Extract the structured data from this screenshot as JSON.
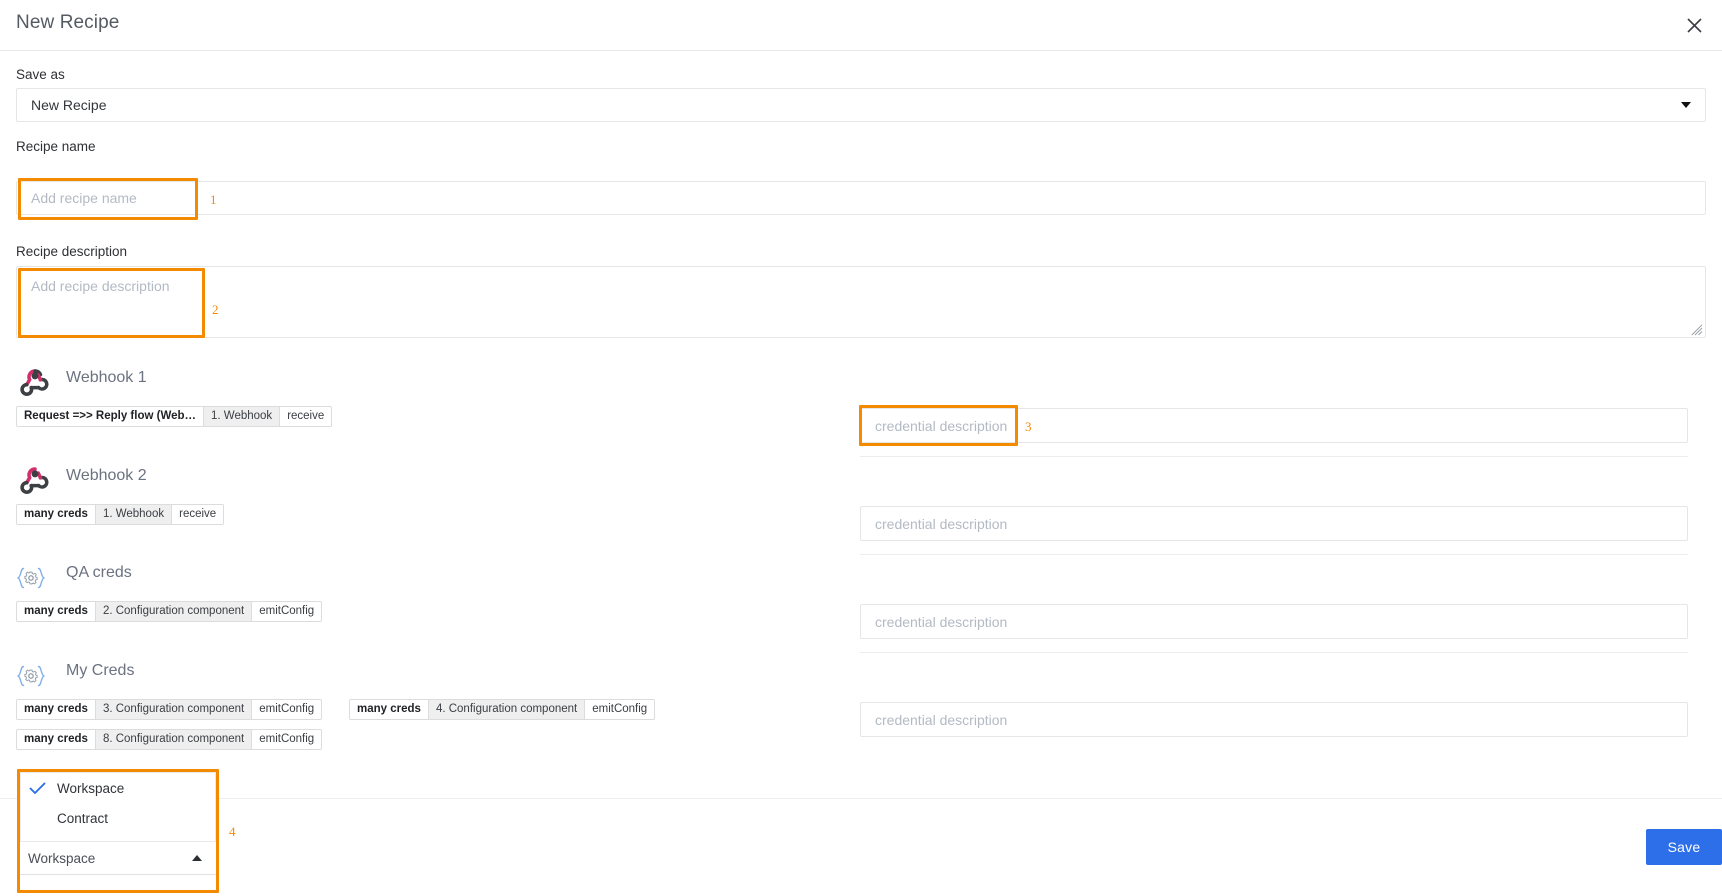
{
  "window": {
    "title": "New Recipe",
    "close_icon": "close-icon"
  },
  "colors": {
    "accent_blue": "#2c6fe8",
    "annotation_orange": "#f48a00",
    "chip_gray": "#efefef",
    "placeholder": "#b3bac4",
    "webhook_pink": "#d1306d",
    "config_blue": "#7fb0e8"
  },
  "form": {
    "save_as": {
      "label": "Save as",
      "value": "New Recipe",
      "caret_icon": "chevron-down-icon"
    },
    "recipe_name": {
      "label": "Recipe name",
      "value": "",
      "placeholder": "Add recipe name"
    },
    "recipe_description": {
      "label": "Recipe description",
      "value": "",
      "placeholder": "Add recipe description"
    }
  },
  "credential_placeholder": "credential description",
  "sections": [
    {
      "icon": "webhook-icon",
      "title": "Webhook 1",
      "credential_value": "",
      "chip_rows": [
        [
          {
            "name": "Request =>> Reply flow (Web…",
            "step": "1. Webhook",
            "action": "receive"
          }
        ]
      ]
    },
    {
      "icon": "webhook-icon",
      "title": "Webhook 2",
      "credential_value": "",
      "chip_rows": [
        [
          {
            "name": "many creds",
            "step": "1. Webhook",
            "action": "receive"
          }
        ]
      ]
    },
    {
      "icon": "config-icon",
      "title": "QA creds",
      "credential_value": "",
      "chip_rows": [
        [
          {
            "name": "many creds",
            "step": "2. Configuration component",
            "action": "emitConfig"
          }
        ]
      ]
    },
    {
      "icon": "config-icon",
      "title": "My Creds",
      "credential_value": "",
      "chip_rows": [
        [
          {
            "name": "many creds",
            "step": "3. Configuration component",
            "action": "emitConfig"
          },
          {
            "name": "many creds",
            "step": "4. Configuration component",
            "action": "emitConfig"
          }
        ],
        [
          {
            "name": "many creds",
            "step": "8. Configuration component",
            "action": "emitConfig"
          }
        ]
      ]
    }
  ],
  "scope_dropdown": {
    "selected": "Workspace",
    "caret_icon": "chevron-up-icon",
    "options": [
      {
        "label": "Workspace",
        "checked": true
      },
      {
        "label": "Contract",
        "checked": false
      }
    ]
  },
  "footer": {
    "save_label": "Save"
  },
  "annotations": [
    {
      "number": "1"
    },
    {
      "number": "2"
    },
    {
      "number": "3"
    },
    {
      "number": "4"
    }
  ]
}
